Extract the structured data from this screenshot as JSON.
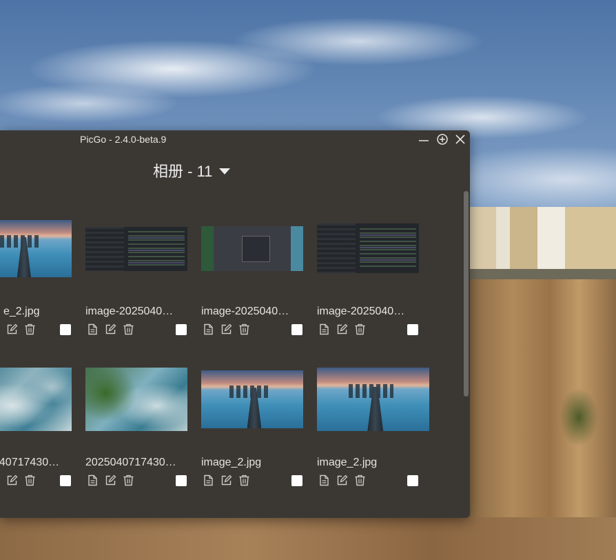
{
  "window": {
    "title": "PicGo - 2.4.0-beta.9"
  },
  "album": {
    "title": "相册 - 11"
  },
  "gallery": {
    "items": [
      {
        "name": "e_2.jpg",
        "art": "pier"
      },
      {
        "name": "image-2025040…",
        "art": "code"
      },
      {
        "name": "image-2025040…",
        "art": "dialog"
      },
      {
        "name": "image-2025040…",
        "art": "code"
      },
      {
        "name": "040717430…",
        "art": "sea"
      },
      {
        "name": "2025040717430…",
        "art": "green"
      },
      {
        "name": "image_2.jpg",
        "art": "pier"
      },
      {
        "name": "image_2.jpg",
        "art": "pier"
      }
    ]
  },
  "colors": {
    "window_bg": "#3b3834",
    "text": "#e6e4e0",
    "icon": "#cfccc7"
  },
  "icons": {
    "minimize": "minimize-icon",
    "maximize": "maximize-icon",
    "close": "close-icon",
    "copy": "document-icon",
    "edit": "edit-icon",
    "delete": "trash-icon",
    "dropdown": "caret-down-icon"
  }
}
